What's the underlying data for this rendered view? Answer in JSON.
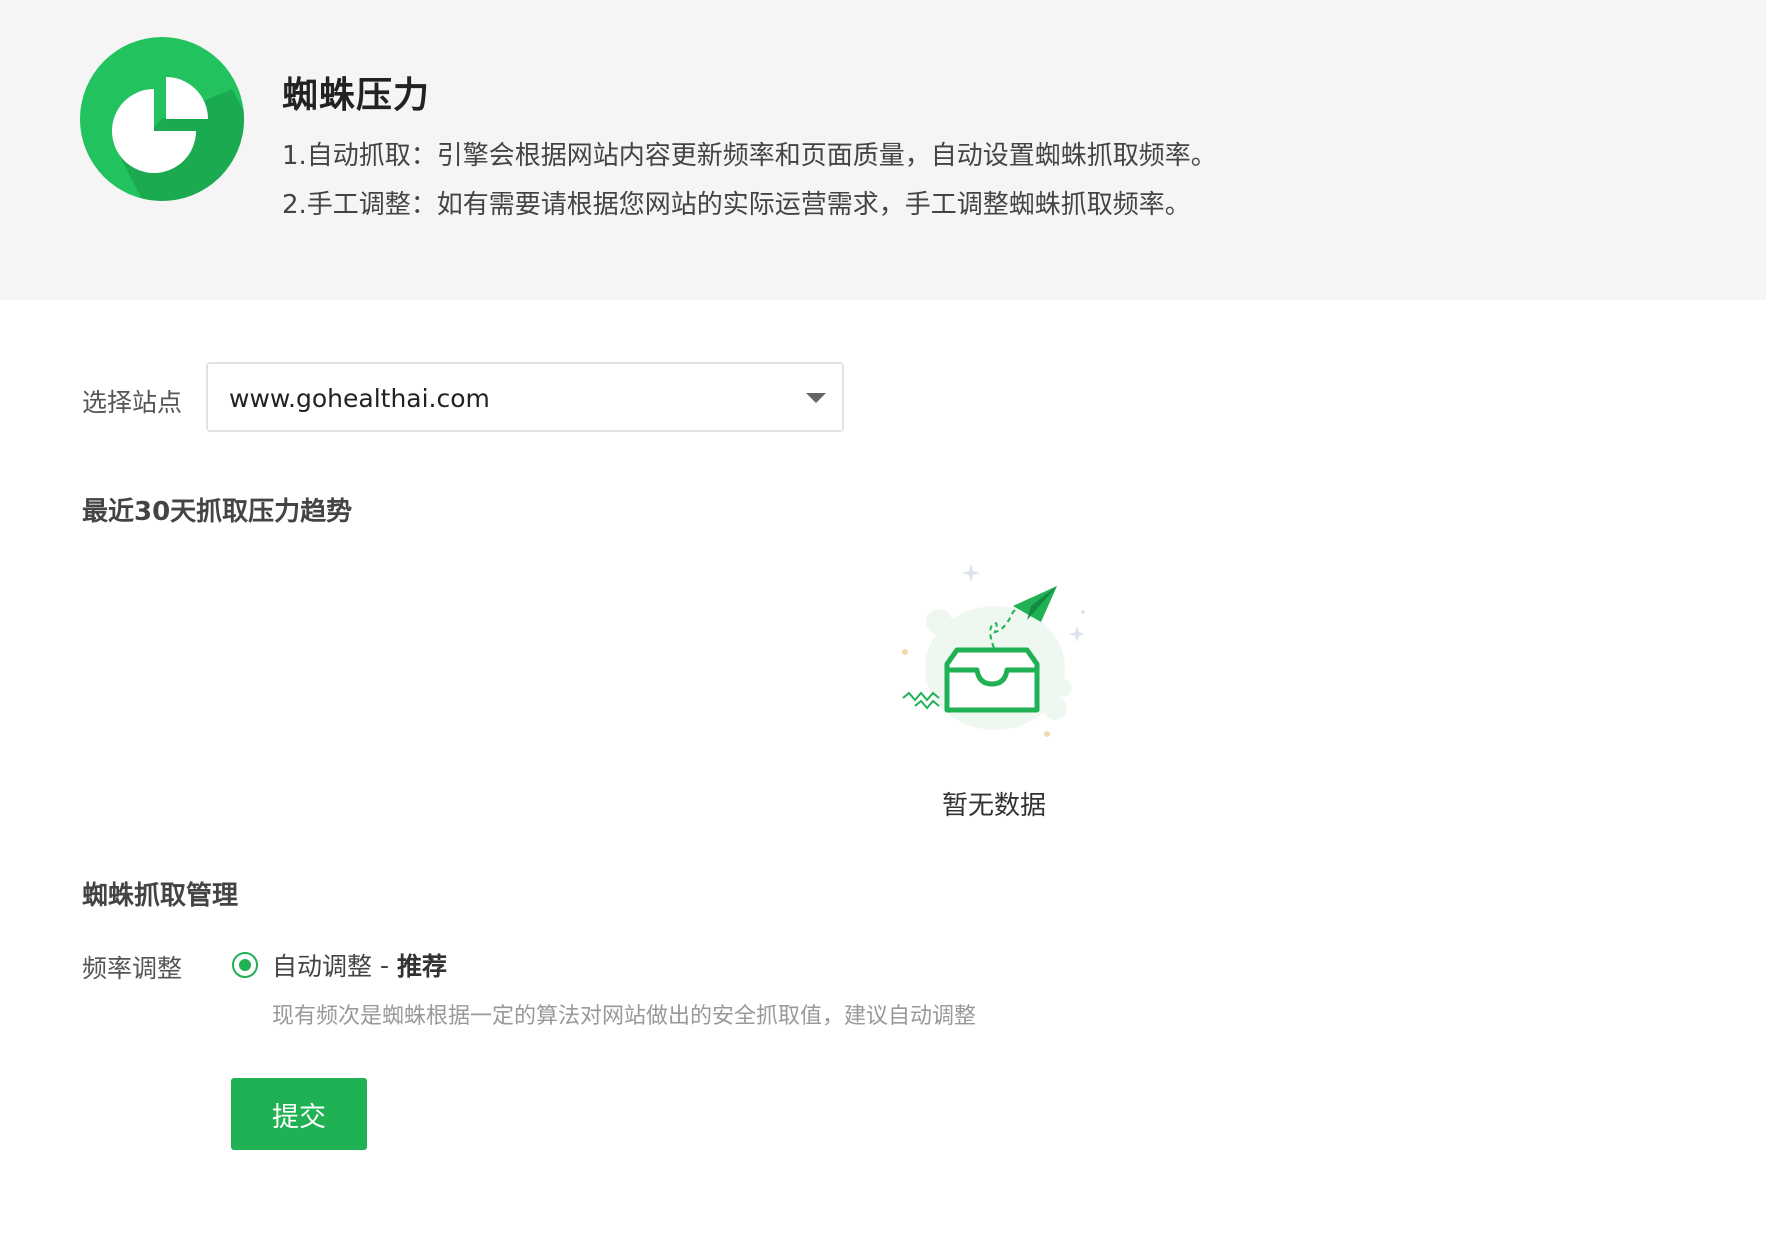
{
  "header": {
    "title": "蜘蛛压力",
    "desc_1": "1.自动抓取：引擎会根据网站内容更新频率和页面质量，自动设置蜘蛛抓取频率。",
    "desc_2": "2.手工调整：如有需要请根据您网站的实际运营需求，手工调整蜘蛛抓取频率。",
    "logo_icon": "pie-chart-icon"
  },
  "site_selector": {
    "label": "选择站点",
    "value": "www.gohealthai.com",
    "arrow_icon": "caret-down-icon"
  },
  "trend": {
    "title": "最近30天抓取压力趋势",
    "empty_text": "暂无数据",
    "empty_icon": "empty-inbox-icon"
  },
  "management": {
    "title": "蜘蛛抓取管理",
    "freq_label": "频率调整",
    "option_label": "自动调整",
    "option_separator": "-",
    "option_tag": "推荐",
    "option_selected": true,
    "hint": "现有频次是蜘蛛根据一定的算法对网站做出的安全抓取值，建议自动调整",
    "submit_label": "提交"
  },
  "colors": {
    "brand_green": "#1fb153",
    "header_bg": "#f5f5f5"
  }
}
